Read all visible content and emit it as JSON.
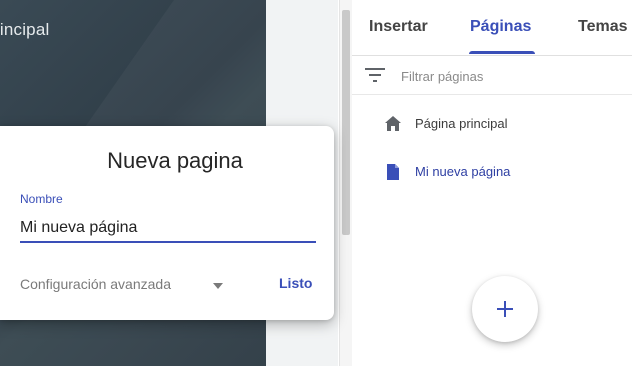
{
  "site": {
    "hero_title": "rincipal"
  },
  "tabs": [
    {
      "label": "Insertar",
      "active": false
    },
    {
      "label": "Páginas",
      "active": true
    },
    {
      "label": "Temas",
      "active": false
    }
  ],
  "filter": {
    "placeholder": "Filtrar páginas",
    "icon": "filter-icon"
  },
  "pages": [
    {
      "label": "Página principal",
      "icon": "home-icon",
      "selected": false
    },
    {
      "label": "Mi nueva página",
      "icon": "page-icon",
      "selected": true
    }
  ],
  "dialog": {
    "title": "Nueva pagina",
    "field_label": "Nombre",
    "name_value": "Mi nueva página",
    "advanced_label": "Configuración avanzada",
    "done_label": "Listo"
  },
  "fab": {
    "icon": "plus-icon"
  },
  "colors": {
    "accent": "#3a4fb8",
    "hero_bg": "#33424c"
  }
}
